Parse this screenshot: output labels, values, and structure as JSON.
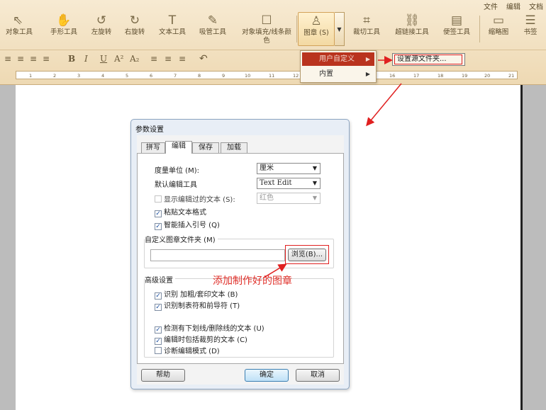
{
  "top_menu": [
    "文件",
    "编辑",
    "文档"
  ],
  "toolbar": {
    "tools": [
      {
        "label": "对象工具",
        "icon": "cursor-arrow-icon"
      },
      {
        "label": "手形工具",
        "icon": "hand-icon"
      },
      {
        "label": "左旋转",
        "icon": "rotate-left-icon"
      },
      {
        "label": "右旋转",
        "icon": "rotate-right-icon"
      },
      {
        "label": "文本工具",
        "icon": "text-tool-icon"
      },
      {
        "label": "吸管工具",
        "icon": "eyedropper-icon"
      },
      {
        "label": "对象填充/线条颜",
        "label2": "色",
        "icon": "fill-color-icon"
      },
      {
        "label": "图章 (S)",
        "icon": "stamp-icon"
      },
      {
        "label": "裁切工具",
        "icon": "crop-icon"
      },
      {
        "label": "超链接工具",
        "icon": "hyperlink-icon"
      },
      {
        "label": "便签工具",
        "icon": "sticky-note-icon"
      },
      {
        "label": "缩略图",
        "icon": "thumbnail-icon"
      },
      {
        "label": "书签",
        "icon": "bookmark-list-icon"
      }
    ]
  },
  "format_bar": [
    "≡",
    "≡",
    "≡",
    "≡",
    "B",
    "I",
    "U",
    "A²",
    "A₂",
    "≡",
    "≡",
    "≡",
    "↶"
  ],
  "ruler": [
    "1",
    "2",
    "3",
    "4",
    "5",
    "6",
    "7",
    "8",
    "9",
    "10",
    "11",
    "12",
    "16",
    "17",
    "18",
    "19",
    "20",
    "21"
  ],
  "stamp_menu": {
    "items": [
      {
        "label": "用户自定义",
        "highlighted": true
      },
      {
        "label": "内置",
        "highlighted": false
      }
    ],
    "submenu": "设置源文件夹..."
  },
  "dialog": {
    "title": "参数设置",
    "tabs": [
      "拼写",
      "编辑",
      "保存",
      "加载"
    ],
    "active_tab": "编辑",
    "unit_label": "度量单位 (M):",
    "unit_value": "厘米",
    "edit_tool_label": "默认编辑工具",
    "edit_tool_value": "Text Edit",
    "show_edited_label": "显示编辑过的文本 (S):",
    "show_edited_color": "红色",
    "paste_format": "粘贴文本格式",
    "smart_quotes": "智能插入引号 (Q)",
    "custom_stamp_folder": "自定义图章文件夹 (M)",
    "browse": "浏览(B)...",
    "advanced": "高级设置",
    "adv_options": [
      {
        "label": "识别 加粗/套印文本 (B)",
        "checked": true
      },
      {
        "label": "识别制表符和前导符 (T)",
        "checked": true
      },
      {
        "label": "检测有下划线/删除线的文本 (U)",
        "checked": true
      },
      {
        "label": "编辑时包括裁剪的文本 (C)",
        "checked": true
      },
      {
        "label": "诊断编辑模式 (D)",
        "checked": false
      }
    ],
    "help": "帮助",
    "ok": "确定",
    "cancel": "取消"
  },
  "annotation": "添加制作好的图章",
  "colors": {
    "accent_red": "#e02020",
    "menu_highlight": "#b9331e"
  }
}
